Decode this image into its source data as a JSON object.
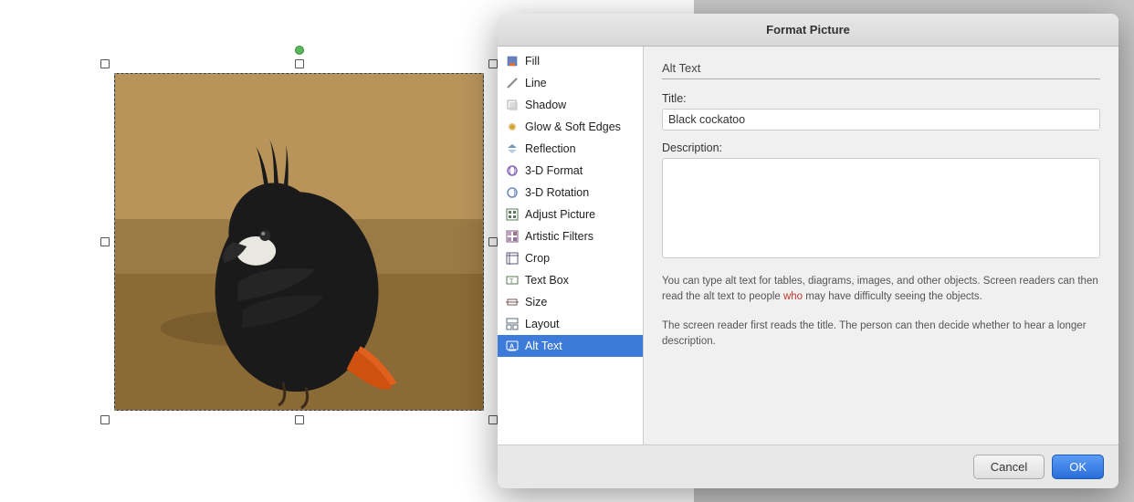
{
  "dialog": {
    "title": "Format Picture",
    "sections": {
      "alt_text_header": "Alt Text"
    },
    "fields": {
      "title_label": "Title:",
      "title_value": "Black cockatoo",
      "description_label": "Description:",
      "description_value": ""
    },
    "info_texts": {
      "paragraph1": "You can type alt text for tables, diagrams, images, and other objects. Screen readers can then read the alt text to people who may have difficulty seeing the objects.",
      "paragraph1_highlight": "who",
      "paragraph2": "The screen reader first reads the title. The person can then decide whether to hear a longer description."
    },
    "buttons": {
      "cancel": "Cancel",
      "ok": "OK"
    }
  },
  "sidebar": {
    "items": [
      {
        "id": "fill",
        "label": "Fill",
        "icon": "◈"
      },
      {
        "id": "line",
        "label": "Line",
        "icon": "╱"
      },
      {
        "id": "shadow",
        "label": "Shadow",
        "icon": "◻"
      },
      {
        "id": "glow",
        "label": "Glow & Soft Edges",
        "icon": "✦"
      },
      {
        "id": "reflection",
        "label": "Reflection",
        "icon": "⌒"
      },
      {
        "id": "3dformat",
        "label": "3-D Format",
        "icon": "◈"
      },
      {
        "id": "3drotation",
        "label": "3-D Rotation",
        "icon": "↻"
      },
      {
        "id": "adjust",
        "label": "Adjust Picture",
        "icon": "▦"
      },
      {
        "id": "artistic",
        "label": "Artistic Filters",
        "icon": "▦"
      },
      {
        "id": "crop",
        "label": "Crop",
        "icon": "▦"
      },
      {
        "id": "textbox",
        "label": "Text Box",
        "icon": "▢"
      },
      {
        "id": "size",
        "label": "Size",
        "icon": "↔"
      },
      {
        "id": "layout",
        "label": "Layout",
        "icon": "▦"
      },
      {
        "id": "alttext",
        "label": "Alt Text",
        "icon": "♿",
        "selected": true
      }
    ]
  }
}
